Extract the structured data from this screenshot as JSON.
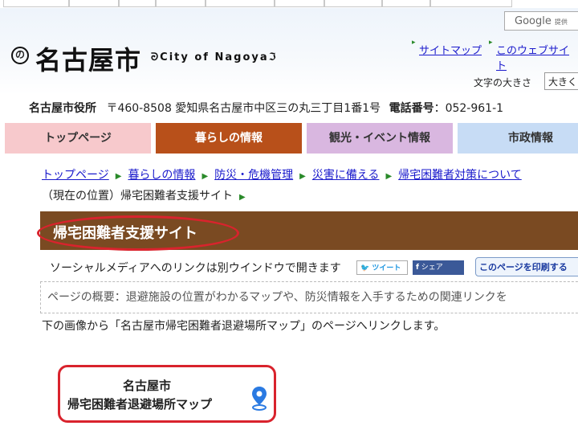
{
  "header": {
    "google_label": "Google",
    "google_sub": "提供",
    "logo_mark": "の",
    "city_name": "名古屋市",
    "city_en": "City of Nagoya",
    "links": [
      "サイトマップ",
      "このウェブサイト"
    ],
    "fontsize_label": "文字の大きさ",
    "fontsize_value": "大きく"
  },
  "address": {
    "org": "名古屋市役所",
    "postal_address": "〒460-8508 愛知県名古屋市中区三の丸三丁目1番1号",
    "phone_label": "電話番号",
    "phone": "：052-961-1"
  },
  "tabs": [
    {
      "label": "トップページ",
      "color": "#f7c9cc",
      "text_color": "#333333"
    },
    {
      "label": "暮らしの情報",
      "color": "#b8501a",
      "text_color": "#ffffff"
    },
    {
      "label": "観光・イベント情報",
      "color": "#d9b7e0",
      "text_color": "#333333"
    },
    {
      "label": "市政情報",
      "color": "#c7dcf5",
      "text_color": "#333333"
    }
  ],
  "breadcrumb": [
    "トップページ",
    "暮らしの情報",
    "防災・危機管理",
    "災害に備える",
    "帰宅困難者対策について"
  ],
  "current_location": "（現在の位置）帰宅困難者支援サイト",
  "page_title": "帰宅困難者支援サイト",
  "social": {
    "note": "ソーシャルメディアへのリンクは別ウインドウで開きます",
    "tweet": "ツイート",
    "share": "シェア",
    "print": "このページを印刷する"
  },
  "summary": "ページの概要：退避施設の位置がわかるマップや、防災情報を入手するための関連リンクを",
  "intro": "下の画像から「名古屋市帰宅困難者退避場所マップ」のページへリンクします。",
  "banner": {
    "line1": "名古屋市",
    "line2": "帰宅困難者退避場所マップ"
  },
  "colors": {
    "title_bar": "#7a4a22",
    "highlight": "#d9232d",
    "link": "#1a1acc",
    "pin": "#2a7ae2"
  }
}
